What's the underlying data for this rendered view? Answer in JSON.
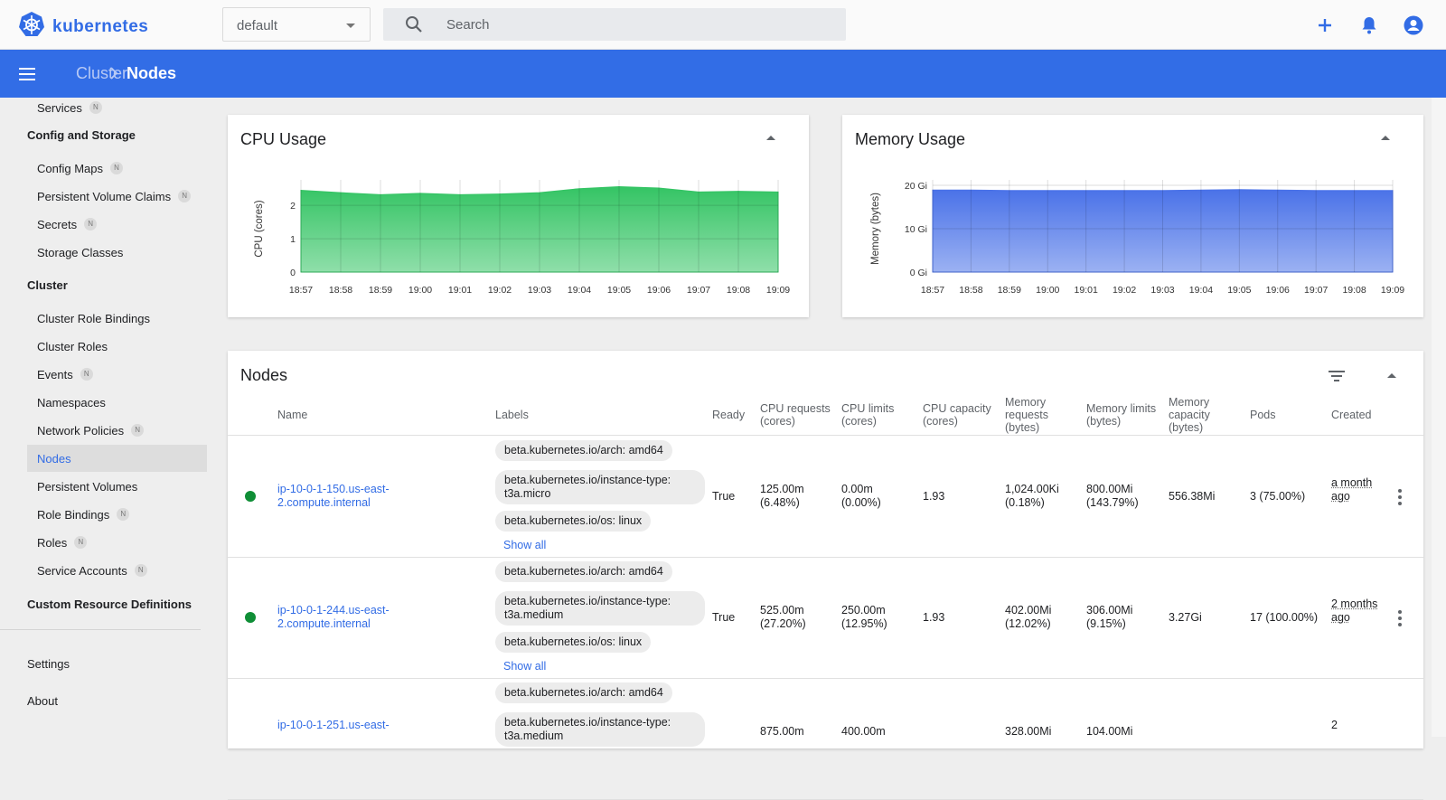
{
  "app": {
    "name": "kubernetes"
  },
  "header": {
    "namespace": "default",
    "search_placeholder": "Search"
  },
  "breadcrumb": {
    "parent": "Cluster",
    "current": "Nodes"
  },
  "sidebar": {
    "partial_item": {
      "label": "Services",
      "badge": "N"
    },
    "config_storage": {
      "title": "Config and Storage",
      "items": [
        {
          "label": "Config Maps",
          "badge": "N"
        },
        {
          "label": "Persistent Volume Claims",
          "badge": "N"
        },
        {
          "label": "Secrets",
          "badge": "N"
        },
        {
          "label": "Storage Classes",
          "badge": ""
        }
      ]
    },
    "cluster": {
      "title": "Cluster",
      "items": [
        {
          "label": "Cluster Role Bindings",
          "badge": ""
        },
        {
          "label": "Cluster Roles",
          "badge": ""
        },
        {
          "label": "Events",
          "badge": "N"
        },
        {
          "label": "Namespaces",
          "badge": ""
        },
        {
          "label": "Network Policies",
          "badge": "N"
        },
        {
          "label": "Nodes",
          "badge": "",
          "active": true
        },
        {
          "label": "Persistent Volumes",
          "badge": ""
        },
        {
          "label": "Role Bindings",
          "badge": "N"
        },
        {
          "label": "Roles",
          "badge": "N"
        },
        {
          "label": "Service Accounts",
          "badge": "N"
        }
      ]
    },
    "crd": "Custom Resource Definitions",
    "settings": "Settings",
    "about": "About"
  },
  "cpu_card": {
    "title": "CPU Usage"
  },
  "memory_card": {
    "title": "Memory Usage"
  },
  "chart_data": [
    {
      "type": "area",
      "ylabel": "CPU (cores)",
      "x": [
        "18:57",
        "18:58",
        "18:59",
        "19:00",
        "19:01",
        "19:02",
        "19:03",
        "19:04",
        "19:05",
        "19:06",
        "19:07",
        "19:08",
        "19:09"
      ],
      "ylim": [
        0,
        2.6
      ],
      "yticks": [
        {
          "value": 0,
          "label": "0"
        },
        {
          "value": 1,
          "label": "1"
        },
        {
          "value": 2,
          "label": "2"
        }
      ],
      "series": [
        {
          "values": [
            2.45,
            2.38,
            2.32,
            2.36,
            2.32,
            2.34,
            2.38,
            2.5,
            2.56,
            2.52,
            2.4,
            2.42,
            2.4
          ]
        }
      ],
      "color": "#34c464",
      "grid": true
    },
    {
      "type": "area",
      "ylabel": "Memory (bytes)",
      "x": [
        "18:57",
        "18:58",
        "18:59",
        "19:00",
        "19:01",
        "19:02",
        "19:03",
        "19:04",
        "19:05",
        "19:06",
        "19:07",
        "19:08",
        "19:09"
      ],
      "ylim": [
        0,
        20
      ],
      "yticks": [
        {
          "value": 0,
          "label": "0 Gi"
        },
        {
          "value": 10,
          "label": "10 Gi"
        },
        {
          "value": 20,
          "label": "20 Gi"
        }
      ],
      "series": [
        {
          "values": [
            18.9,
            18.9,
            18.8,
            18.8,
            18.8,
            18.8,
            18.8,
            18.9,
            19.0,
            18.9,
            18.8,
            18.8,
            18.8
          ]
        }
      ],
      "color": "#4a72e8",
      "grid": true
    }
  ],
  "nodes": {
    "title": "Nodes",
    "columns": {
      "name": "Name",
      "labels": "Labels",
      "ready": "Ready",
      "cpu_requests": "CPU requests (cores)",
      "cpu_limits": "CPU limits (cores)",
      "cpu_capacity": "CPU capacity (cores)",
      "memory_requests": "Memory requests (bytes)",
      "memory_limits": "Memory limits (bytes)",
      "memory_capacity": "Memory capacity (bytes)",
      "pods": "Pods",
      "created": "Created"
    },
    "show_all": "Show all",
    "rows": [
      {
        "name": "ip-10-0-1-150.us-east-2.compute.internal",
        "labels": [
          "beta.kubernetes.io/arch: amd64",
          "beta.kubernetes.io/instance-type: t3a.micro",
          "beta.kubernetes.io/os: linux"
        ],
        "ready": "True",
        "cpu_requests": "125.00m (6.48%)",
        "cpu_limits": "0.00m (0.00%)",
        "cpu_capacity": "1.93",
        "memory_requests": "1,024.00Ki (0.18%)",
        "memory_limits": "800.00Mi (143.79%)",
        "memory_capacity": "556.38Mi",
        "pods": "3 (75.00%)",
        "created": "a month ago"
      },
      {
        "name": "ip-10-0-1-244.us-east-2.compute.internal",
        "labels": [
          "beta.kubernetes.io/arch: amd64",
          "beta.kubernetes.io/instance-type: t3a.medium",
          "beta.kubernetes.io/os: linux"
        ],
        "ready": "True",
        "cpu_requests": "525.00m (27.20%)",
        "cpu_limits": "250.00m (12.95%)",
        "cpu_capacity": "1.93",
        "memory_requests": "402.00Mi (12.02%)",
        "memory_limits": "306.00Mi (9.15%)",
        "memory_capacity": "3.27Gi",
        "pods": "17 (100.00%)",
        "created": "2 months ago"
      },
      {
        "name": "ip-10-0-1-251.us-east-",
        "labels": [
          "beta.kubernetes.io/arch: amd64",
          "beta.kubernetes.io/instance-type: t3a.medium"
        ],
        "ready": "",
        "cpu_requests": "875.00m",
        "cpu_limits": "400.00m",
        "cpu_capacity": "",
        "memory_requests": "328.00Mi",
        "memory_limits": "104.00Mi",
        "memory_capacity": "",
        "pods": "",
        "created": "2"
      }
    ]
  }
}
